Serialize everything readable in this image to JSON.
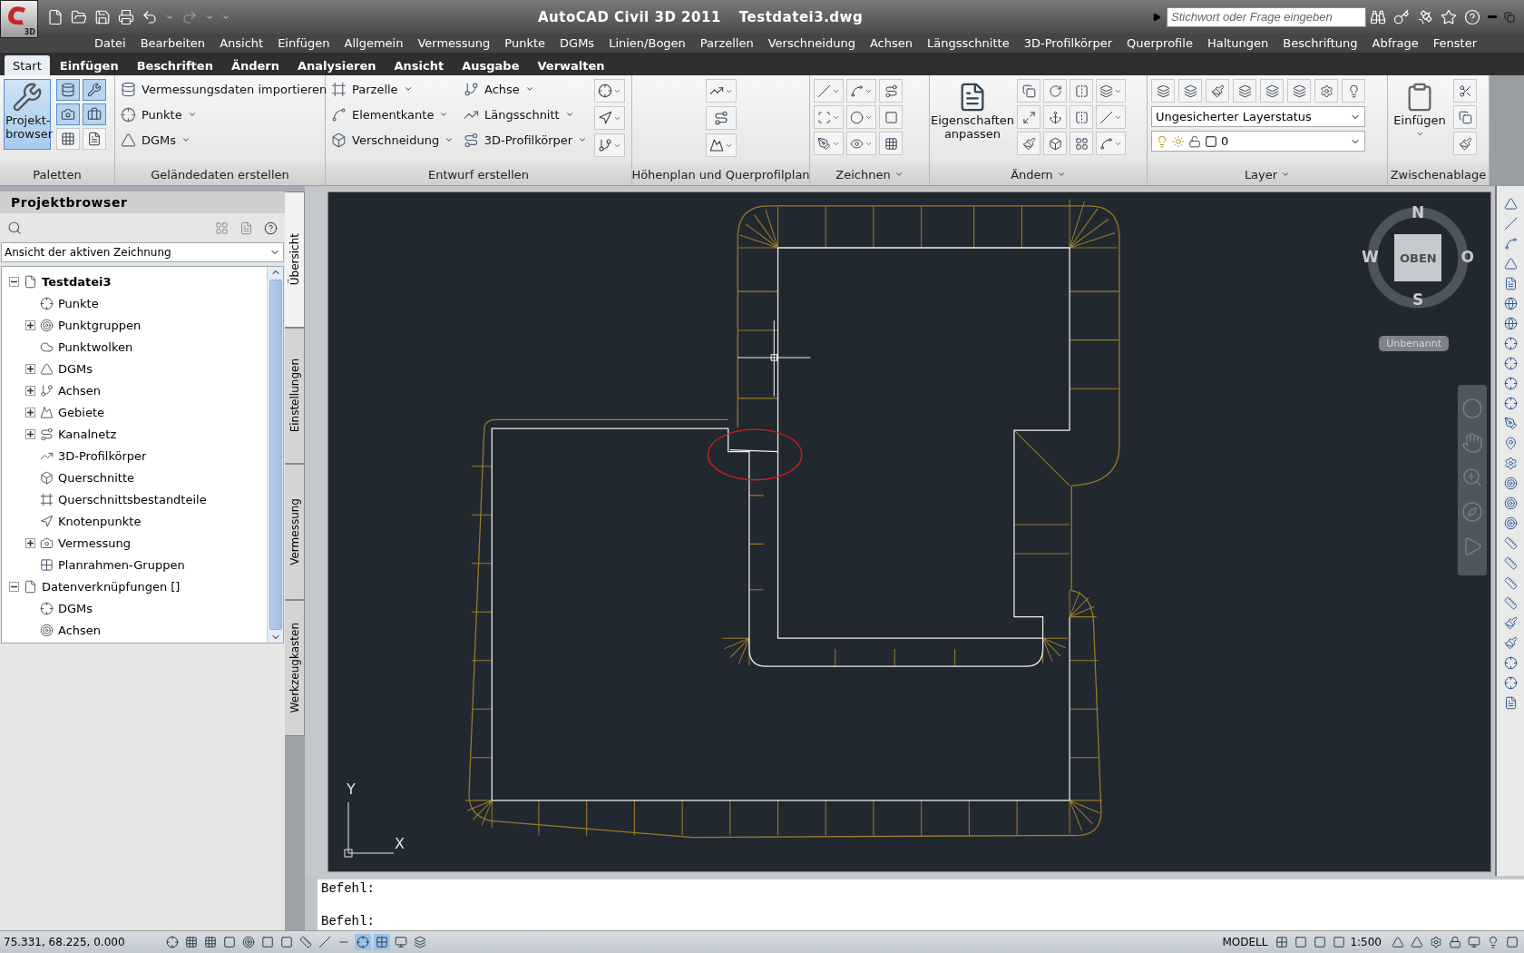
{
  "title_bar": {
    "app_badge": "3D",
    "app_title": "AutoCAD Civil 3D 2011",
    "file_name": "Testdatei3.dwg",
    "search": {
      "placeholder": "Stichwort oder Frage eingeben"
    }
  },
  "menu_bar": [
    "Datei",
    "Bearbeiten",
    "Ansicht",
    "Einfügen",
    "Allgemein",
    "Vermessung",
    "Punkte",
    "DGMs",
    "Linien/Bogen",
    "Parzellen",
    "Verschneidung",
    "Achsen",
    "Längsschnitte",
    "3D-Profilkörper",
    "Querprofile",
    "Haltungen",
    "Beschriftung",
    "Abfrage",
    "Fenster"
  ],
  "ribbon_tabs": [
    {
      "label": "Start",
      "selected": true
    },
    {
      "label": "Einfügen",
      "selected": false
    },
    {
      "label": "Beschriften",
      "selected": false
    },
    {
      "label": "Ändern",
      "selected": false
    },
    {
      "label": "Analysieren",
      "selected": false
    },
    {
      "label": "Ansicht",
      "selected": false
    },
    {
      "label": "Ausgabe",
      "selected": false
    },
    {
      "label": "Verwalten",
      "selected": false
    }
  ],
  "ribbon": {
    "paletten": {
      "title": "Paletten",
      "big_button": {
        "label": "Projekt-browser",
        "active": true
      },
      "small_tools": [
        {
          "active": true
        },
        {
          "active": true
        },
        {
          "active": true
        },
        {
          "active": true
        },
        {
          "active": false
        },
        {
          "active": false
        }
      ]
    },
    "gelaende": {
      "title": "Geländedaten erstellen",
      "items": [
        {
          "label": "Vermessungsdaten importieren",
          "dropdown": false
        },
        {
          "label": "Punkte",
          "dropdown": true
        },
        {
          "label": "DGMs",
          "dropdown": true
        }
      ]
    },
    "entwurf": {
      "title": "Entwurf erstellen",
      "columns": [
        [
          {
            "label": "Parzelle",
            "dropdown": true
          },
          {
            "label": "Elementkante",
            "dropdown": true
          },
          {
            "label": "Verschneidung",
            "dropdown": true
          }
        ],
        [
          {
            "label": "Achse",
            "dropdown": true
          },
          {
            "label": "Längsschnitt",
            "dropdown": true
          },
          {
            "label": "3D-Profilkörper",
            "dropdown": true
          }
        ]
      ]
    },
    "hoehenplan": {
      "title": "Höhenplan und Querprofilplan"
    },
    "zeichnen": {
      "title": "Zeichnen"
    },
    "aendern": {
      "title": "Ändern",
      "big_button": {
        "label": "Eigenschaften anpassen"
      }
    },
    "layer": {
      "title": "Layer",
      "state_field": {
        "value": "Ungesicherter Layerstatus"
      },
      "layer_field": {
        "value": "0"
      }
    },
    "zwischenablage": {
      "title": "Zwischenablage",
      "big_button": {
        "label": "Einfügen"
      }
    }
  },
  "project_browser": {
    "title": "Projektbrowser",
    "view_select": {
      "value": "Ansicht der aktiven Zeichnung"
    },
    "tree": [
      {
        "label": "Testdatei3",
        "current": true,
        "expanded": true,
        "children": [
          {
            "label": "Punkte"
          },
          {
            "label": "Punktgruppen",
            "expanded": false
          },
          {
            "label": "Punktwolken"
          },
          {
            "label": "DGMs",
            "expanded": false
          },
          {
            "label": "Achsen",
            "expanded": false
          },
          {
            "label": "Gebiete",
            "expanded": false
          },
          {
            "label": "Kanalnetz",
            "expanded": false
          },
          {
            "label": "3D-Profilkörper"
          },
          {
            "label": "Querschnitte"
          },
          {
            "label": "Querschnittsbestandteile"
          },
          {
            "label": "Knotenpunkte"
          },
          {
            "label": "Vermessung",
            "expanded": false
          },
          {
            "label": "Planrahmen-Gruppen"
          }
        ]
      },
      {
        "label": "Datenverknüpfungen []",
        "current": false,
        "expanded": true,
        "children": [
          {
            "label": "DGMs"
          },
          {
            "label": "Achsen"
          }
        ]
      }
    ]
  },
  "side_tabs": [
    {
      "label": "Übersicht",
      "selected": true
    },
    {
      "label": "Einstellungen",
      "selected": false
    },
    {
      "label": "Vermessung",
      "selected": false
    },
    {
      "label": "Werkzeugkasten",
      "selected": false
    }
  ],
  "viewcube": {
    "north": "N",
    "west": "W",
    "east": "O",
    "south": "S",
    "face": "OBEN",
    "ucs_menu": "Unbenannt"
  },
  "ucs": {
    "y": "Y",
    "x": "X"
  },
  "command_lines": [
    "Befehl:",
    "Befehl:"
  ],
  "status_bar": {
    "coordinates": "75.331, 68.225, 0.000",
    "space": "MODELL",
    "scale": "1:500"
  }
}
